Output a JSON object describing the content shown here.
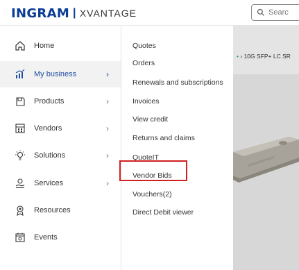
{
  "header": {
    "logo_brand": "INGRAM",
    "logo_separator": "|",
    "logo_product": "XVANTAGE",
    "search_placeholder": "Searc"
  },
  "sidebar": {
    "items": [
      {
        "label": "Home",
        "icon": "home-icon",
        "has_submenu": false
      },
      {
        "label": "My business",
        "icon": "chart-icon",
        "has_submenu": true,
        "active": true
      },
      {
        "label": "Products",
        "icon": "box-icon",
        "has_submenu": true
      },
      {
        "label": "Vendors",
        "icon": "vendors-icon",
        "has_submenu": true
      },
      {
        "label": "Solutions",
        "icon": "lightbulb-icon",
        "has_submenu": true
      },
      {
        "label": "Services",
        "icon": "services-icon",
        "has_submenu": true
      },
      {
        "label": "Resources",
        "icon": "resources-icon",
        "has_submenu": false
      },
      {
        "label": "Events",
        "icon": "calendar-icon",
        "has_submenu": false
      }
    ],
    "chevron": "›"
  },
  "submenu": {
    "items": [
      "Quotes",
      "Orders",
      "Renewals and subscriptions",
      "Invoices",
      "View credit",
      "Returns and claims",
      "QuoteIT",
      "Vendor Bids",
      "Vouchers(2)",
      "Direct Debit viewer"
    ],
    "highlighted": "Vendor Bids"
  },
  "content": {
    "breadcrumb_separator": "›",
    "breadcrumb_current": "10G SFP+ LC SR"
  },
  "colors": {
    "brand_blue": "#0b3c96",
    "active_text": "#1f4fa3",
    "highlight_border": "#d12020",
    "active_bg": "#f2f2f2"
  }
}
